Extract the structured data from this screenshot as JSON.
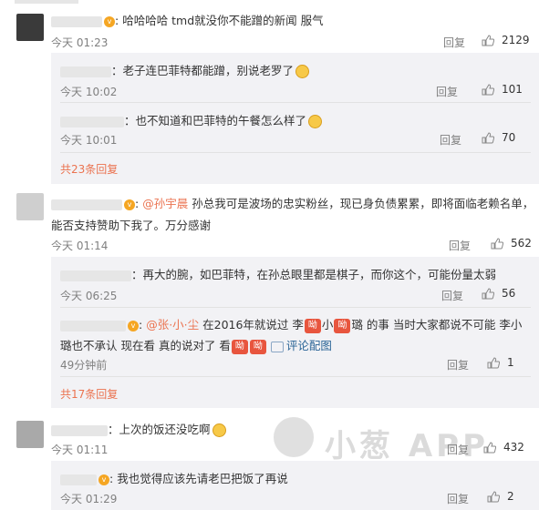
{
  "top_partial": "...",
  "comments": [
    {
      "text": "哈哈哈哈 tmd就没你不能蹭的新闻 服气",
      "time": "今天 01:23",
      "reply": "回复",
      "likes": "2129"
    },
    {
      "text": "孙总我可是波场的忠实粉丝，现已身负债累累，即将面临老赖名单，",
      "text2": "能否支持赞助下我了。万分感谢",
      "mention": "@孙宇晨",
      "time": "今天 01:14",
      "reply": "回复",
      "likes": "562"
    },
    {
      "text": "上次的饭还没吃啊",
      "time": "今天 01:11",
      "reply": "回复",
      "likes": "432"
    }
  ],
  "sub_replies_1": [
    {
      "text": "老子连巴菲特都能蹭，别说老罗了",
      "time": "今天 10:02",
      "reply": "回复",
      "likes": "101"
    },
    {
      "text": "也不知道和巴菲特的午餐怎么样了",
      "time": "今天 10:01",
      "reply": "回复",
      "likes": "70"
    }
  ],
  "more_1": "共23条回复",
  "sub_replies_2": [
    {
      "text": "再大的腕，如巴菲特，在孙总眼里都是棋子，而你这个，可能份量太弱",
      "time": "今天 06:25",
      "reply": "回复",
      "likes": "56"
    },
    {
      "mention": "@张·小·尘",
      "text_a": "在2016年就说过 李",
      "text_b": "小",
      "text_c": "璐 的事 当时大家都说不可能 李小",
      "text2_a": "璐也不承认 现在看 真的说对了 看",
      "pic_label": "评论配图",
      "time": "49分钟前",
      "reply": "回复",
      "likes": "1"
    }
  ],
  "more_2": "共17条回复",
  "sub_replies_3": [
    {
      "text": "我也觉得应该先请老巴把饭了再说",
      "time": "今天 01:29",
      "reply": "回复",
      "likes": "2"
    }
  ],
  "tag_glyph": "呦",
  "watermark": "小葱 APP"
}
